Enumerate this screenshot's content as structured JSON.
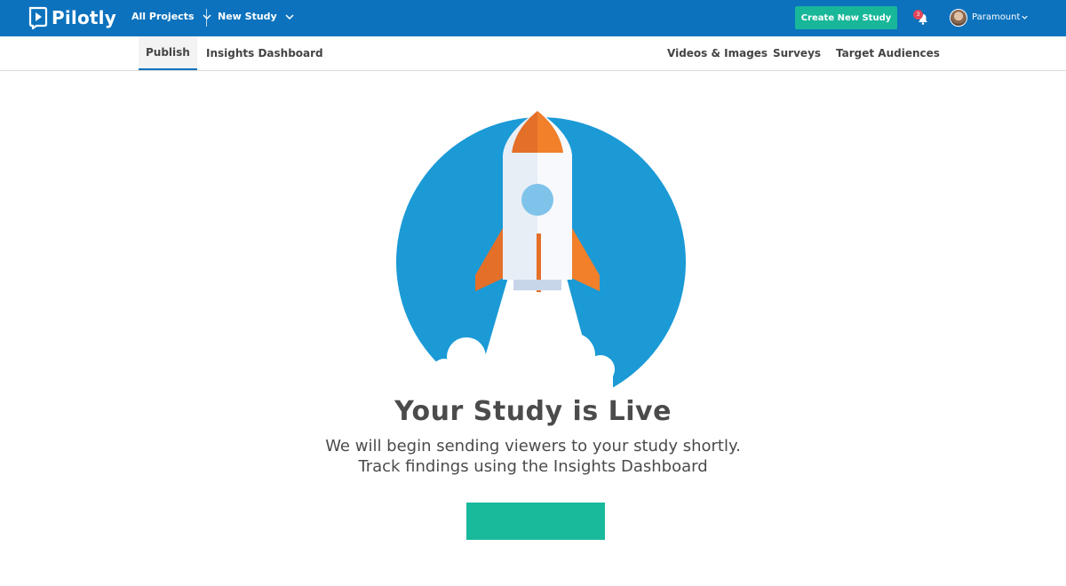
{
  "app": {
    "name": "Pilotly"
  },
  "topbar": {
    "projects_label": "All Projects",
    "study_label": "New Study",
    "create_button": "Create New Study",
    "notification_count": "3",
    "user_name": "Paramount",
    "colors": {
      "bar": "#0c72bd",
      "accent": "#18b79a",
      "badge": "#e0465a"
    }
  },
  "tabs": {
    "publish": "Publish",
    "insights": "Insights Dashboard",
    "videos": "Videos & Images",
    "surveys": "Surveys",
    "audiences": "Target Audiences"
  },
  "main": {
    "illustration": "rocket-launch-illustration",
    "title": "Your Study is Live",
    "line1": "We will begin sending viewers to your study shortly.",
    "line2": "Track findings using the Insights Dashboard",
    "cta_label": ""
  }
}
